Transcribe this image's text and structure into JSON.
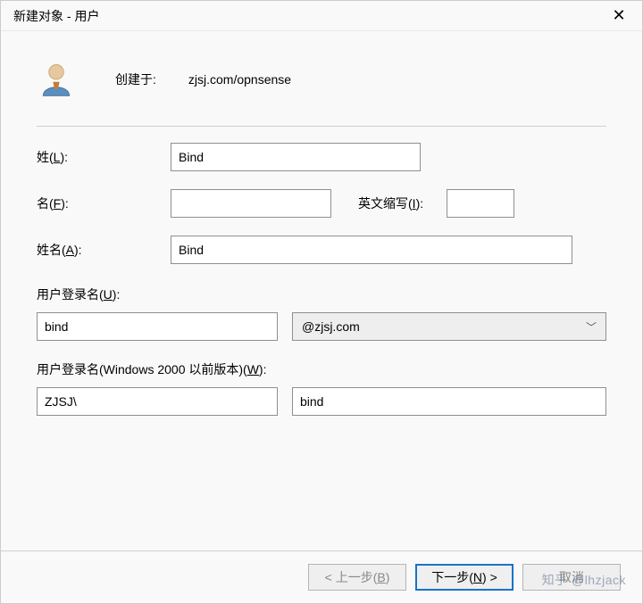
{
  "window": {
    "title": "新建对象 - 用户",
    "close_glyph": "✕"
  },
  "header": {
    "created_label": "创建于:",
    "created_value": "zjsj.com/opnsense"
  },
  "fields": {
    "surname_label_pre": "姓(",
    "surname_hotkey": "L",
    "surname_label_post": "):",
    "surname_value": "Bind",
    "given_label_pre": "名(",
    "given_hotkey": "F",
    "given_label_post": "):",
    "given_value": "",
    "initials_label_pre": "英文缩写(",
    "initials_hotkey": "I",
    "initials_label_post": "):",
    "initials_value": "",
    "fullname_label_pre": "姓名(",
    "fullname_hotkey": "A",
    "fullname_label_post": "):",
    "fullname_value": "Bind"
  },
  "login": {
    "label_pre": "用户登录名(",
    "label_hotkey": "U",
    "label_post": "):",
    "value": "bind",
    "domain_selected": "@zjsj.com"
  },
  "win2k": {
    "label_pre": "用户登录名(Windows 2000 以前版本)(",
    "label_hotkey": "W",
    "label_post": "):",
    "domain_prefix": "ZJSJ\\",
    "sam_value": "bind"
  },
  "buttons": {
    "back_pre": "< 上一步(",
    "back_hotkey": "B",
    "back_post": ")",
    "next_pre": "下一步(",
    "next_hotkey": "N",
    "next_post": ") >",
    "cancel_label": "取消"
  },
  "watermark": "知乎 @lhzjack"
}
